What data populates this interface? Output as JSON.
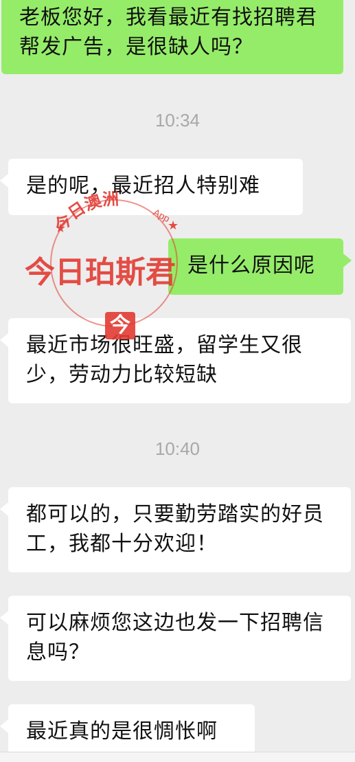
{
  "messages": [
    {
      "side": "out",
      "text": "老板您好，我看最近有找招聘君帮发广告，是很缺人吗？"
    },
    {
      "type": "time",
      "text": "10:34"
    },
    {
      "side": "in",
      "text": "是的呢，最近招人特别难"
    },
    {
      "side": "out",
      "text": "是什么原因呢"
    },
    {
      "side": "in",
      "text": "最近市场很旺盛，留学生又很少，劳动力比较短缺"
    },
    {
      "type": "time",
      "text": "10:40"
    },
    {
      "side": "in",
      "text": "都可以的，只要勤劳踏实的好员工，我都十分欢迎！"
    },
    {
      "side": "in",
      "text": "可以麻烦您这边也发一下招聘信息吗？"
    },
    {
      "side": "in",
      "text": "最近真的是很惆怅啊"
    }
  ],
  "watermark": {
    "arc_text": "今日澳洲",
    "app_label": "App",
    "main_text": "今日珀斯君",
    "logo_glyph": "今",
    "color": "#e23b32"
  },
  "colors": {
    "background": "#ededed",
    "incoming_bubble": "#ffffff",
    "outgoing_bubble": "#95ec69",
    "timestamp": "#a8a8a8"
  }
}
